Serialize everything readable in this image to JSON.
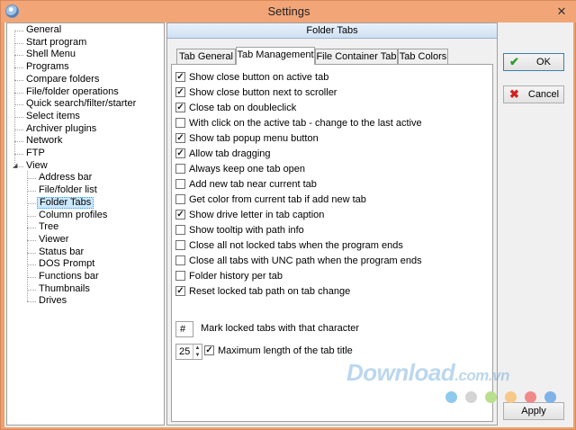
{
  "window": {
    "title": "Settings",
    "close_glyph": "✕"
  },
  "tree": {
    "items": [
      {
        "label": "General",
        "level": 0
      },
      {
        "label": "Start program",
        "level": 0
      },
      {
        "label": "Shell Menu",
        "level": 0
      },
      {
        "label": "Programs",
        "level": 0
      },
      {
        "label": "Compare folders",
        "level": 0
      },
      {
        "label": "File/folder operations",
        "level": 0
      },
      {
        "label": "Quick search/filter/starter",
        "level": 0
      },
      {
        "label": "Select items",
        "level": 0
      },
      {
        "label": "Archiver plugins",
        "level": 0
      },
      {
        "label": "Network",
        "level": 0
      },
      {
        "label": "FTP",
        "level": 0
      },
      {
        "label": "View",
        "level": 0,
        "expanded": true
      },
      {
        "label": "Address bar",
        "level": 1
      },
      {
        "label": "File/folder list",
        "level": 1
      },
      {
        "label": "Folder Tabs",
        "level": 1,
        "selected": true
      },
      {
        "label": "Column profiles",
        "level": 1
      },
      {
        "label": "Tree",
        "level": 1
      },
      {
        "label": "Viewer",
        "level": 1
      },
      {
        "label": "Status bar",
        "level": 1
      },
      {
        "label": "DOS Prompt",
        "level": 1
      },
      {
        "label": "Functions bar",
        "level": 1
      },
      {
        "label": "Thumbnails",
        "level": 1
      },
      {
        "label": "Drives",
        "level": 1
      }
    ]
  },
  "panel": {
    "header": "Folder Tabs",
    "tabs": [
      {
        "label": "Tab General",
        "active": false
      },
      {
        "label": "Tab Management",
        "active": true
      },
      {
        "label": "File Container Tab",
        "active": false
      },
      {
        "label": "Tab Colors",
        "active": false
      }
    ],
    "options": [
      {
        "label": "Show close button on active tab",
        "checked": true
      },
      {
        "label": "Show close button next to scroller",
        "checked": true
      },
      {
        "label": "Close tab on doubleclick",
        "checked": true
      },
      {
        "label": "With click on the active tab - change to the last active",
        "checked": false
      },
      {
        "label": "Show tab popup menu button",
        "checked": true
      },
      {
        "label": "Allow tab dragging",
        "checked": true
      },
      {
        "label": "Always keep one tab open",
        "checked": false
      },
      {
        "label": "Add new tab near current tab",
        "checked": false
      },
      {
        "label": "Get color from current tab if add new tab",
        "checked": false
      },
      {
        "label": "Show drive letter in tab caption",
        "checked": true
      },
      {
        "label": "Show tooltip with path info",
        "checked": false
      },
      {
        "label": "Close all not locked tabs when the program ends",
        "checked": false
      },
      {
        "label": "Close all tabs with UNC path when the program ends",
        "checked": false
      },
      {
        "label": "Folder history per tab",
        "checked": false
      },
      {
        "label": "Reset locked tab path on tab change",
        "checked": true
      }
    ],
    "lock_char": {
      "value": "#",
      "label": "Mark locked tabs with that character"
    },
    "max_length": {
      "value": "25",
      "checked": true,
      "label": "Maximum length of the tab title"
    }
  },
  "buttons": {
    "ok": "OK",
    "cancel": "Cancel",
    "apply": "Apply"
  },
  "watermark": {
    "main": "Download",
    "suffix": ".com.vn"
  },
  "dot_colors": [
    "#8ec9ee",
    "#d4d4d4",
    "#b8e08c",
    "#f6c98a",
    "#f08a8a",
    "#7fb2e6"
  ],
  "colors": {
    "ok_icon": "#2e9b2e",
    "cancel_icon": "#d42020",
    "selection": "#cce8ff"
  }
}
